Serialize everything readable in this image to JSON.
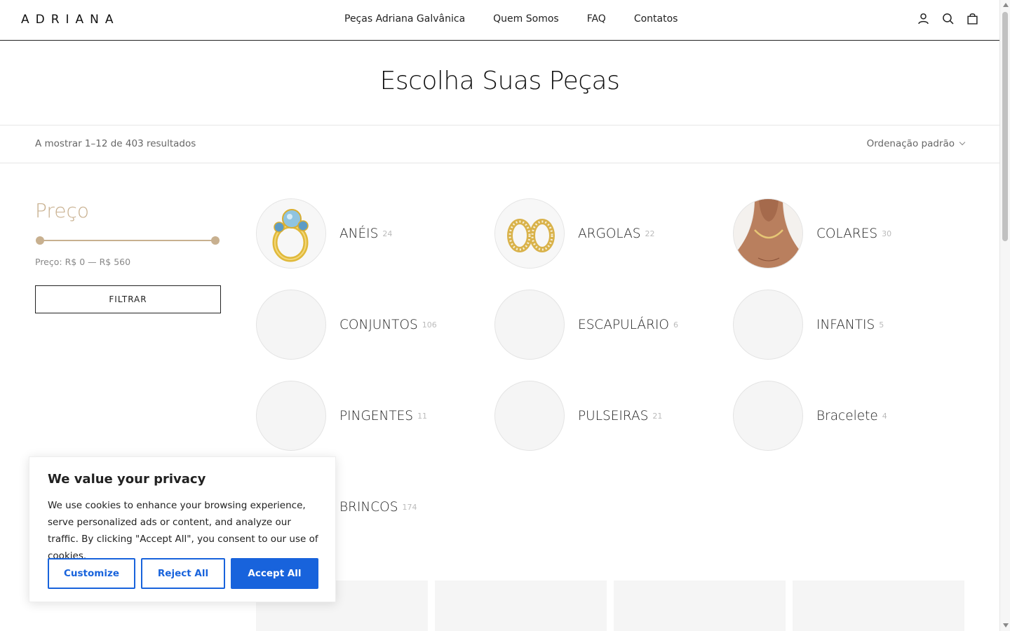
{
  "header": {
    "logo": "ADRIANA",
    "nav": [
      "Peças Adriana Galvânica",
      "Quem Somos",
      "FAQ",
      "Contatos"
    ],
    "icons": [
      "user-icon",
      "search-icon",
      "bag-icon"
    ]
  },
  "page": {
    "title": "Escolha Suas Peças",
    "result_count": "A mostrar 1–12 de 403 resultados",
    "sorting": "Ordenação padrão"
  },
  "filter": {
    "title": "Preço",
    "price_label": "Preço: R$ 0 — R$ 560",
    "button": "FILTRAR",
    "min": 0,
    "max": 560,
    "selected_min_fraction": 0,
    "selected_max_fraction": 1
  },
  "categories": [
    {
      "name": "ANÉIS",
      "count": "24",
      "image": "ring"
    },
    {
      "name": "ARGOLAS",
      "count": "22",
      "image": "hoops"
    },
    {
      "name": "COLARES",
      "count": "30",
      "image": "necklace"
    },
    {
      "name": "CONJUNTOS",
      "count": "106",
      "image": ""
    },
    {
      "name": "ESCAPULÁRIO",
      "count": "6",
      "image": ""
    },
    {
      "name": "INFANTIS",
      "count": "5",
      "image": ""
    },
    {
      "name": "PINGENTES",
      "count": "11",
      "image": ""
    },
    {
      "name": "PULSEIRAS",
      "count": "21",
      "image": ""
    },
    {
      "name": "Bracelete",
      "count": "4",
      "image": ""
    },
    {
      "name": "BRINCOS",
      "count": "174",
      "image": ""
    }
  ],
  "cookie": {
    "title": "We value your privacy",
    "text": "We use cookies to enhance your browsing experience, serve personalized ads or content, and analyze our traffic. By clicking \"Accept All\", you consent to our use of cookies.",
    "customize": "Customize",
    "reject": "Reject All",
    "accept": "Accept All"
  },
  "colors": {
    "accent": "#c8b08f",
    "cookie_blue": "#1863dc"
  }
}
